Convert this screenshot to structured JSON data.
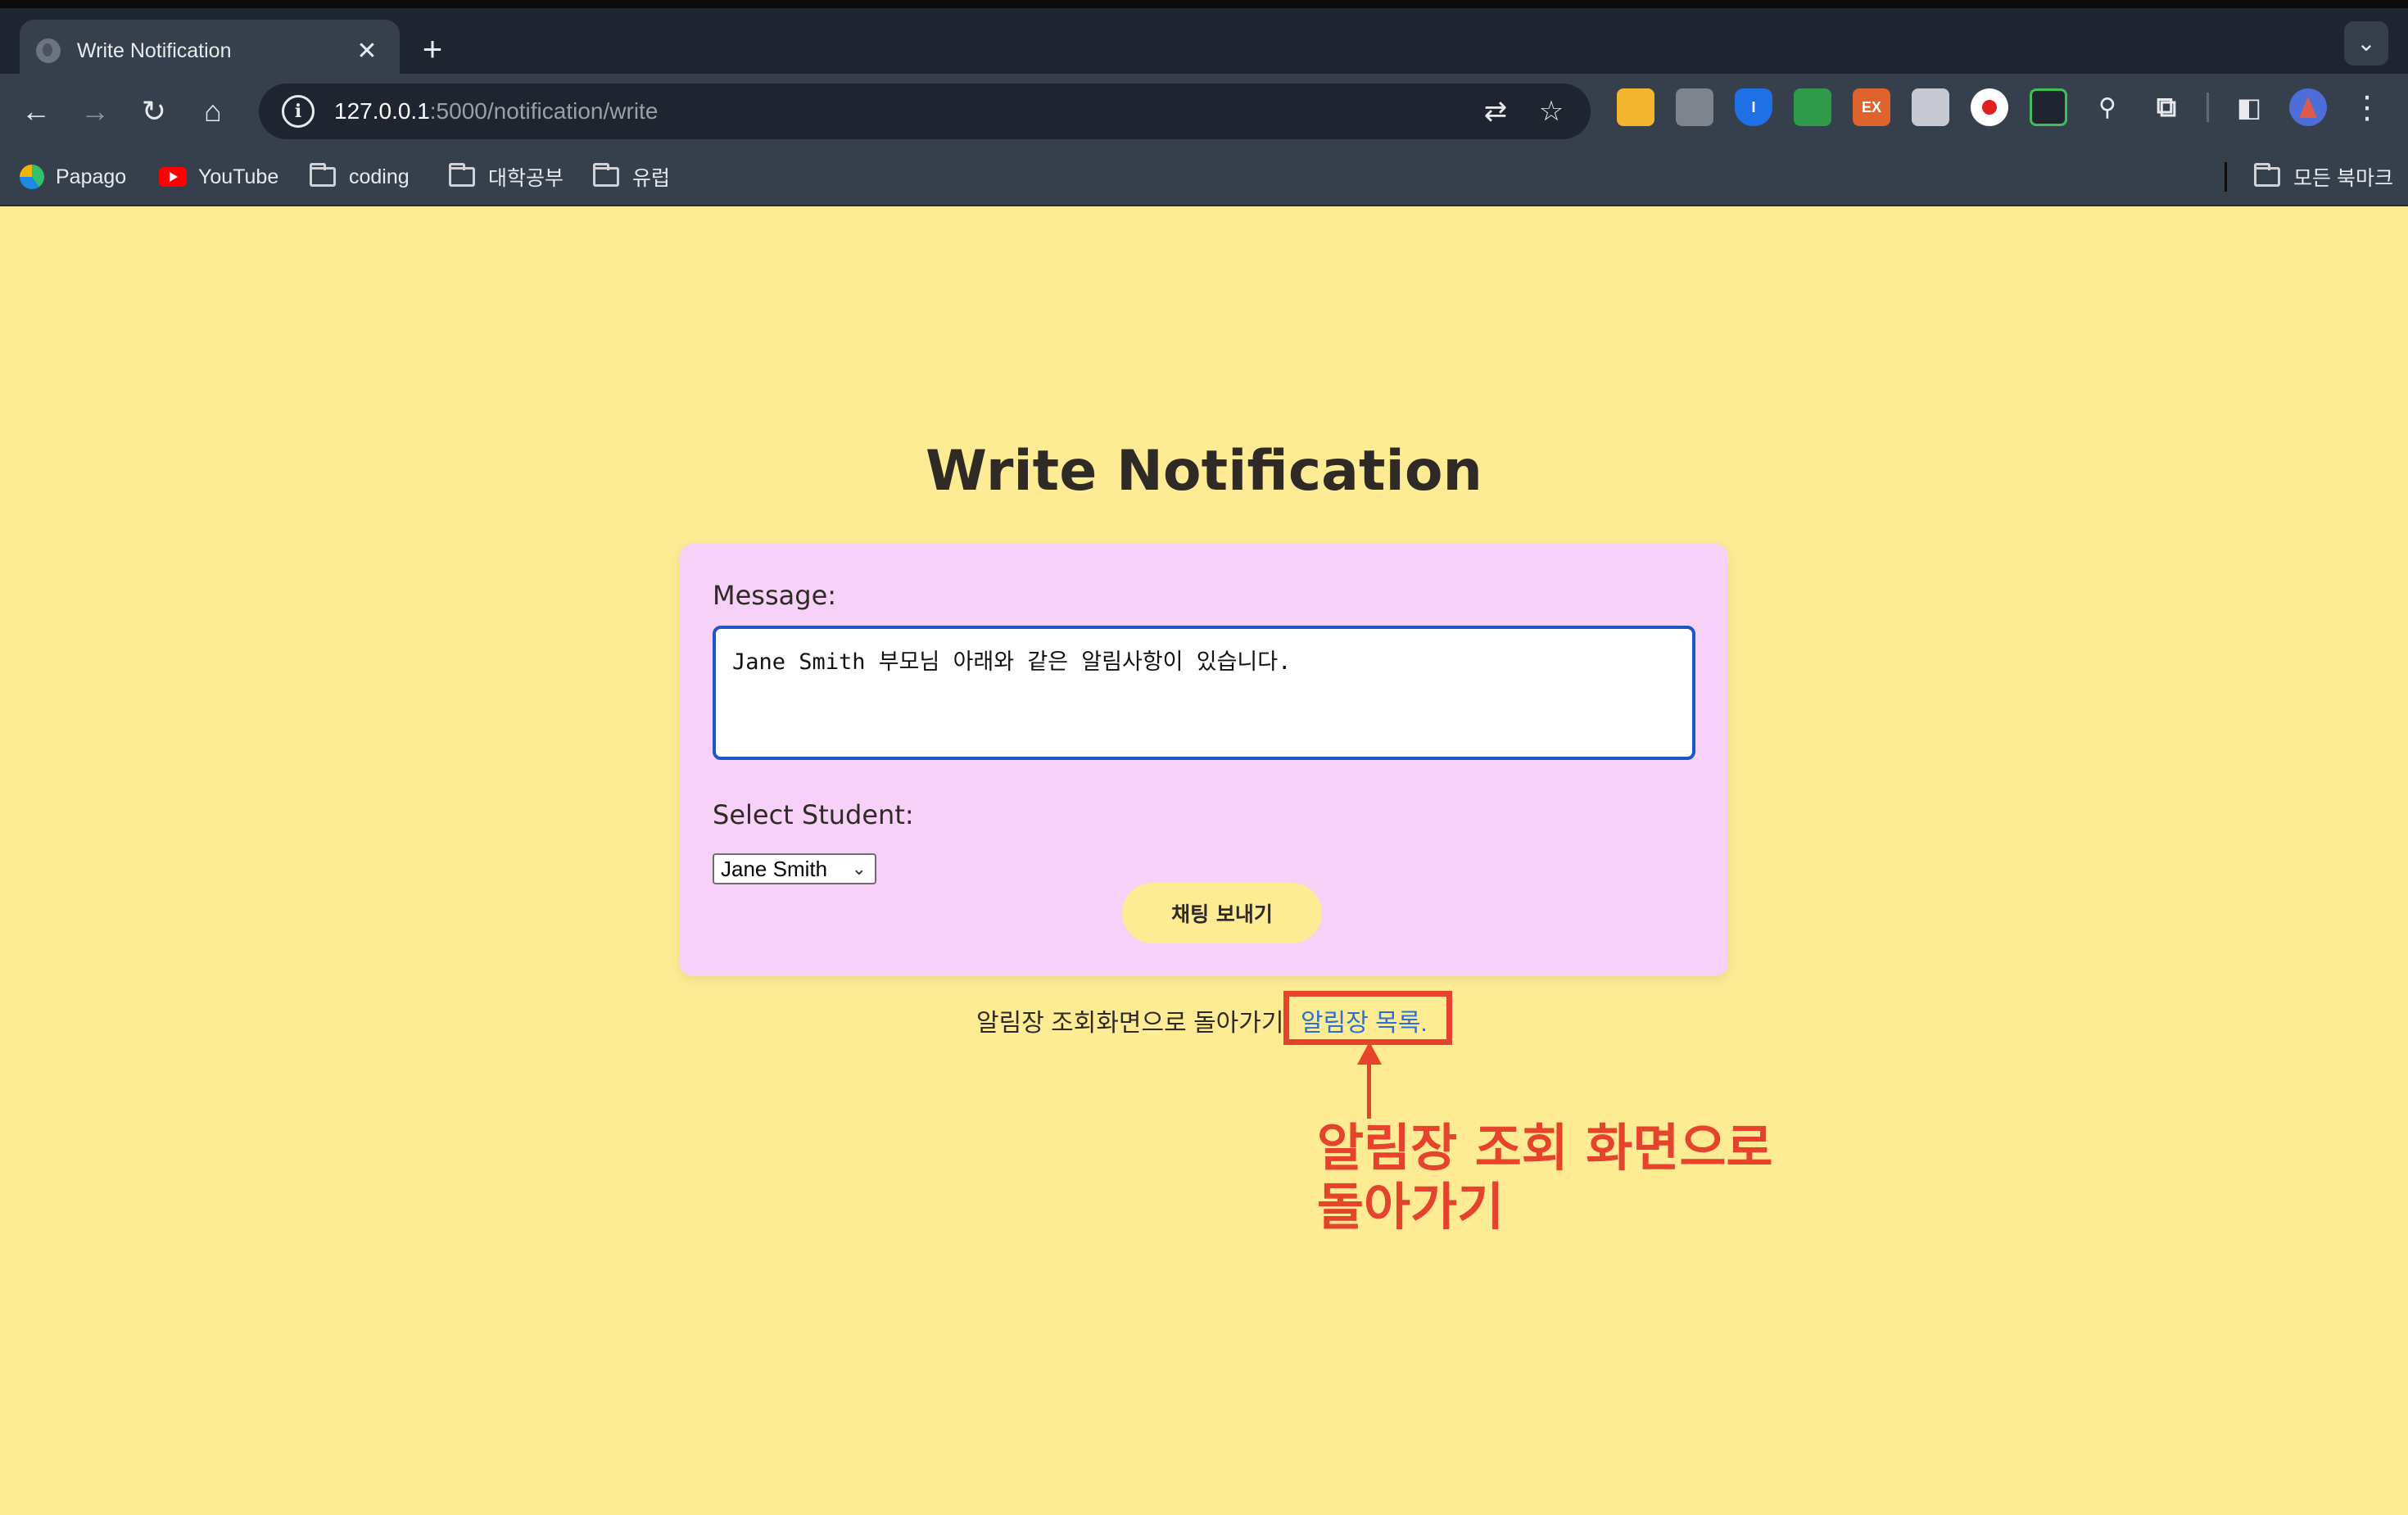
{
  "browser": {
    "tab_title": "Write Notification",
    "tab_close": "✕",
    "new_tab": "+",
    "tab_menu": "⌄",
    "url_host": "127.0.0.1",
    "url_path": ":5000/notification/write",
    "nav": {
      "back": "←",
      "forward": "→",
      "reload": "↻",
      "home": "⌂"
    },
    "bookmarks": [
      {
        "label": "Papago",
        "icon": "papago-icon"
      },
      {
        "label": "YouTube",
        "icon": "youtube-icon"
      },
      {
        "label": "coding",
        "icon": "folder-icon"
      },
      {
        "label": "대학공부",
        "icon": "folder-icon"
      },
      {
        "label": "유럽",
        "icon": "folder-icon"
      }
    ],
    "all_bookmarks": "모든 북마크"
  },
  "page": {
    "title": "Write Notification",
    "message_label": "Message:",
    "message_value": "Jane Smith 부모님 아래와 같은 알림사항이 있습니다.",
    "student_label": "Select Student:",
    "student_selected": "Jane Smith",
    "send_button": "채팅 보내기",
    "back_text": "알림장 조회화면으로 돌아가기",
    "back_link": "알림장 목록."
  },
  "annotation": {
    "line1": "알림장 조회 화면으로",
    "line2": "돌아가기",
    "color": "#e5432b"
  },
  "colors": {
    "page_bg": "#fdec94",
    "card_bg": "#f7d1f8",
    "link": "#2d6fd6"
  }
}
